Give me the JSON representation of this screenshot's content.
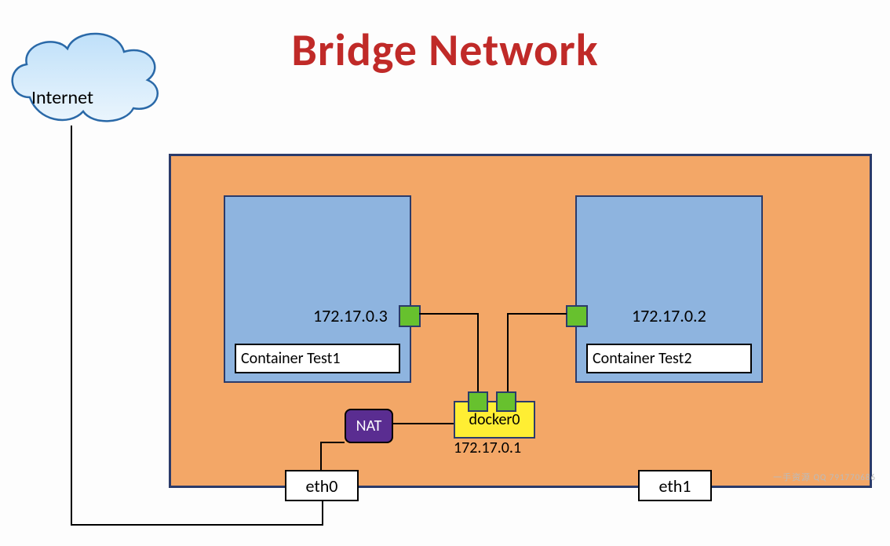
{
  "title": "Bridge Network",
  "internet": {
    "label": "Internet"
  },
  "host": {
    "containers": [
      {
        "name": "Container Test1",
        "ip": "172.17.0.3"
      },
      {
        "name": "Container Test2",
        "ip": "172.17.0.2"
      }
    ],
    "bridge": {
      "name": "docker0",
      "ip": "172.17.0.1"
    },
    "nat": {
      "label": "NAT"
    },
    "interfaces": [
      {
        "name": "eth0"
      },
      {
        "name": "eth1"
      }
    ]
  },
  "watermark": "一手资源 QQ 791770686"
}
